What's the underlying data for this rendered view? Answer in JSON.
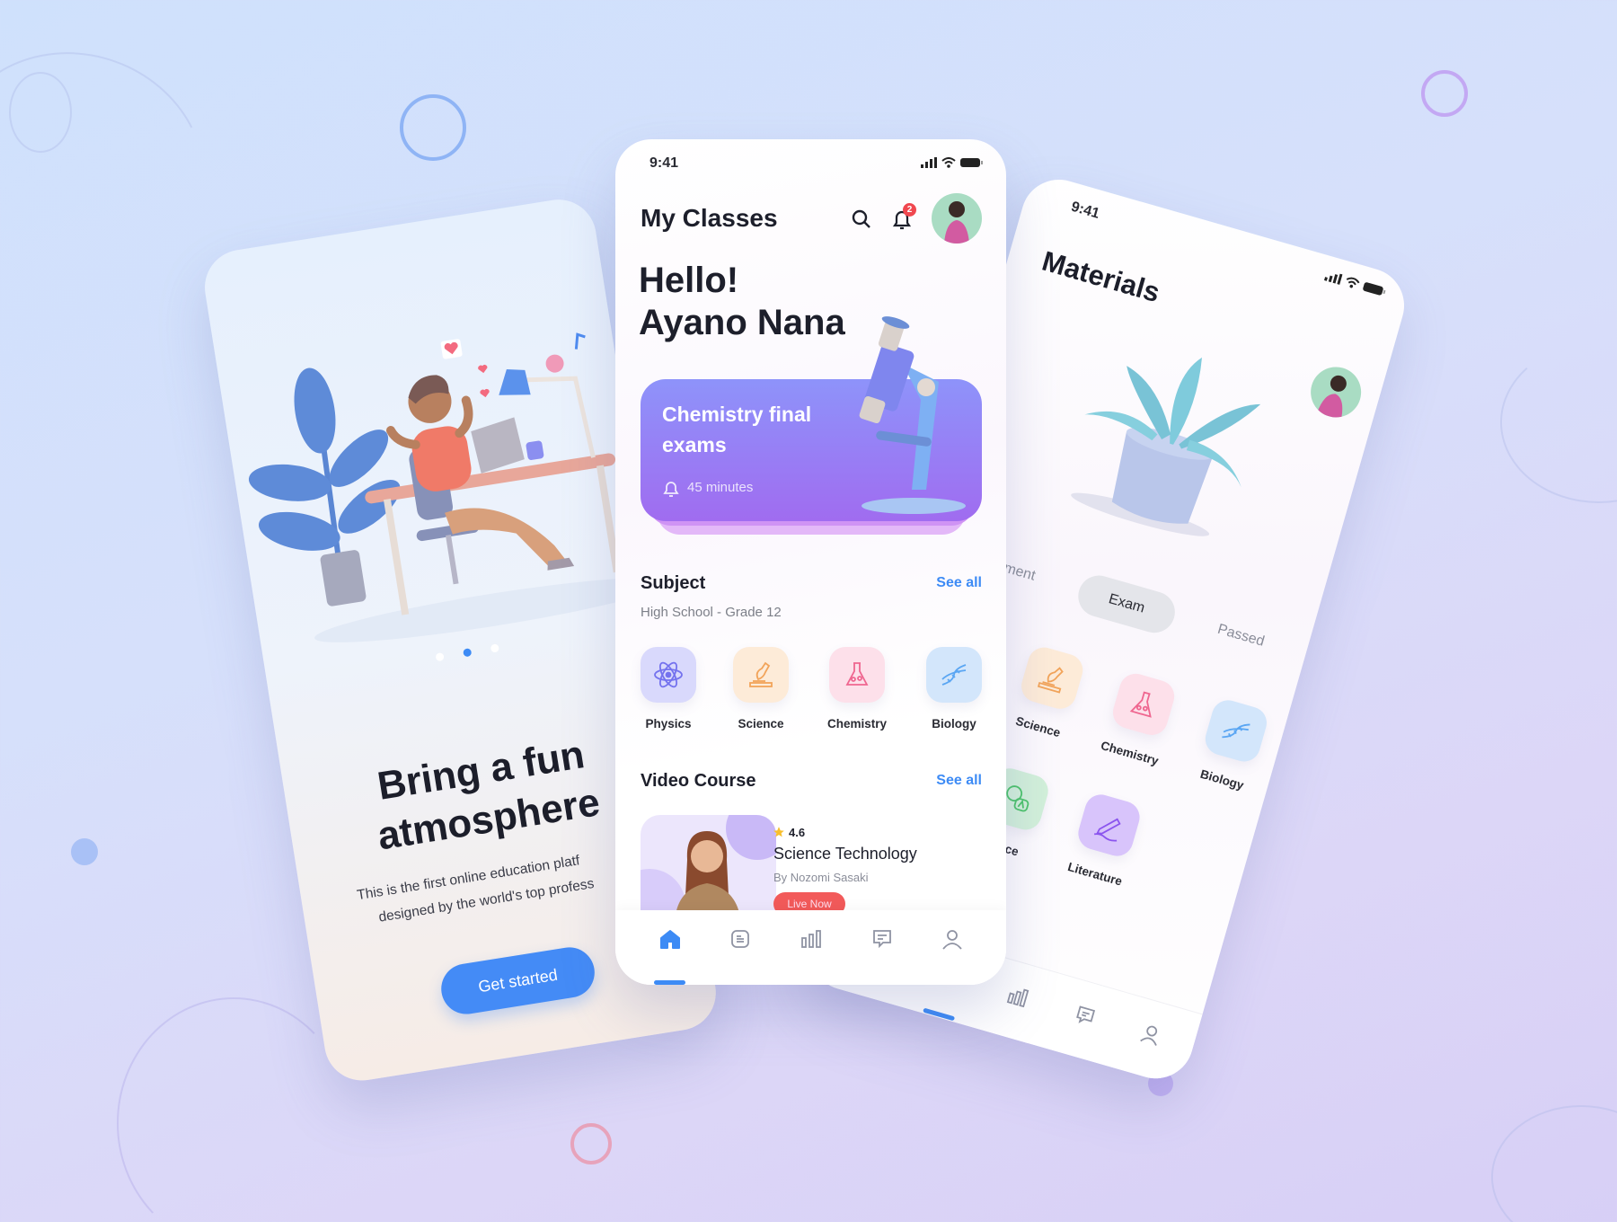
{
  "colors": {
    "accent_blue": "#3d8bf5",
    "exam_card_top": "#8e93fa",
    "exam_card_bottom": "#a06cf0",
    "badge_red": "#f0474f",
    "live_red": "#f25a5a"
  },
  "onboarding": {
    "title_line1": "Bring a fun",
    "title_line2": "atmosphere",
    "desc_line1": "This is the first online education platf",
    "desc_line2": "designed by the world's top profess",
    "button": "Get started",
    "pager": {
      "count": 3,
      "active_index": 1
    }
  },
  "home": {
    "status_time": "9:41",
    "title": "My Classes",
    "notification_count": "2",
    "greeting": "Hello!",
    "name": "Ayano Nana",
    "exam_card": {
      "title_line1": "Chemistry final",
      "title_line2": "exams",
      "duration": "45 minutes",
      "icon": "bell-icon"
    },
    "subject": {
      "heading": "Subject",
      "see_all": "See all",
      "subtitle": "High School - Grade 12",
      "items": [
        {
          "label": "Physics",
          "icon": "atom-icon",
          "bg": "#d9d9fc",
          "fg": "#7472ee"
        },
        {
          "label": "Science",
          "icon": "microscope-icon",
          "bg": "#fdebd8",
          "fg": "#f2a45a"
        },
        {
          "label": "Chemistry",
          "icon": "flask-icon",
          "bg": "#fde0ea",
          "fg": "#ef6690"
        },
        {
          "label": "Biology",
          "icon": "dna-icon",
          "bg": "#d3e6fb",
          "fg": "#5aa6f3"
        }
      ]
    },
    "video_course": {
      "heading": "Video Course",
      "see_all": "See all",
      "course": {
        "rating": "4.6",
        "title": "Science Technology",
        "author": "By Nozomi Sasaki",
        "badge": "Live Now"
      }
    },
    "nav": [
      {
        "icon": "home-icon",
        "active": true
      },
      {
        "icon": "document-icon",
        "active": false
      },
      {
        "icon": "chart-icon",
        "active": false
      },
      {
        "icon": "chat-icon",
        "active": false
      },
      {
        "icon": "profile-icon",
        "active": false
      }
    ]
  },
  "materials": {
    "status_time": "9:41",
    "title": "Materials",
    "tabs": [
      {
        "label": "ument",
        "active": false
      },
      {
        "label": "Exam",
        "active": true
      },
      {
        "label": "Passed",
        "active": false
      }
    ],
    "items": [
      {
        "label": "Science",
        "icon": "microscope-icon",
        "bg": "#fdebd8",
        "fg": "#f2a45a"
      },
      {
        "label": "Chemistry",
        "icon": "flask-icon",
        "bg": "#fde0ea",
        "fg": "#ef6690"
      },
      {
        "label": "Biology",
        "icon": "dna-icon",
        "bg": "#d3e6fb",
        "fg": "#5aa6f3"
      },
      {
        "label": "nce",
        "icon": "translate-icon",
        "bg": "#d2f0da",
        "fg": "#4cc46a"
      },
      {
        "label": "Literature",
        "icon": "pen-icon",
        "bg": "#d8c4fb",
        "fg": "#8b55ee"
      }
    ]
  }
}
